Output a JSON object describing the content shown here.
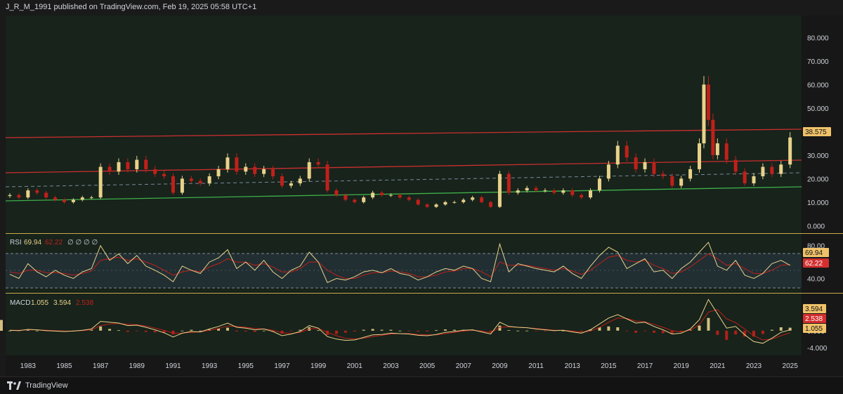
{
  "header": {
    "published": "J_R_M_1991 published on TradingView.com, Feb 19, 2025 05:58 UTC+1"
  },
  "footer": {
    "brand": "TradingView"
  },
  "colors": {
    "background": "#17231b",
    "up_candle": "#e8d28a",
    "down_candle": "#c0201a",
    "upper_channel": "#cc2f2f",
    "lower_channel": "#3fae4a",
    "dashed_mid": "#7a8a9a",
    "rsi_line": "#e8d28a",
    "rsi_signal": "#c0201a",
    "macd_line": "#e8d28a",
    "macd_signal": "#c0201a",
    "label_gold": "#f0c36a",
    "label_red": "#d32f2f"
  },
  "chart_data": [
    {
      "type": "candlestick",
      "name": "price",
      "x_ticks": [
        "1983",
        "1985",
        "1987",
        "1989",
        "1991",
        "1993",
        "1995",
        "1997",
        "1999",
        "2001",
        "2003",
        "2005",
        "2007",
        "2009",
        "2011",
        "2013",
        "2015",
        "2017",
        "2019",
        "2021",
        "2023",
        "2025"
      ],
      "y_ticks": [
        "80.000",
        "70.000",
        "60.000",
        "50.000",
        "40.000",
        "30.000",
        "20.000",
        "10.000",
        "0.000"
      ],
      "ylim": [
        -2,
        87
      ],
      "last_value": "38.575",
      "x": [
        1982.0,
        1982.5,
        1983.0,
        1983.5,
        1984.0,
        1984.5,
        1985.0,
        1985.5,
        1986.0,
        1986.5,
        1987.0,
        1987.5,
        1988.0,
        1988.5,
        1989.0,
        1989.5,
        1990.0,
        1990.5,
        1991.0,
        1991.5,
        1992.0,
        1992.5,
        1993.0,
        1993.5,
        1994.0,
        1994.5,
        1995.0,
        1995.5,
        1996.0,
        1996.5,
        1997.0,
        1997.5,
        1998.0,
        1998.5,
        1999.0,
        1999.5,
        2000.0,
        2000.5,
        2001.0,
        2001.5,
        2002.0,
        2002.5,
        2003.0,
        2003.5,
        2004.0,
        2004.5,
        2005.0,
        2005.5,
        2006.0,
        2006.5,
        2007.0,
        2007.5,
        2008.0,
        2008.5,
        2009.0,
        2009.5,
        2010.0,
        2010.5,
        2011.0,
        2011.5,
        2012.0,
        2012.5,
        2013.0,
        2013.5,
        2014.0,
        2014.5,
        2015.0,
        2015.5,
        2016.0,
        2016.5,
        2017.0,
        2017.5,
        2018.0,
        2018.5,
        2019.0,
        2019.5,
        2020.0,
        2020.25,
        2020.5,
        2020.75,
        2021.0,
        2021.5,
        2022.0,
        2022.5,
        2023.0,
        2023.5,
        2024.0,
        2024.5,
        2025.0
      ],
      "close": [
        13,
        12,
        15,
        14,
        12,
        11,
        10,
        11,
        12,
        12,
        25,
        23,
        27,
        24,
        28,
        24,
        22,
        21,
        14,
        20,
        19,
        18,
        21,
        24,
        29,
        23,
        25,
        22,
        24,
        21,
        17,
        18,
        20,
        27,
        26,
        15,
        13,
        11,
        10,
        12,
        14,
        13,
        13,
        12,
        11,
        9,
        8,
        9,
        10,
        10,
        11,
        12,
        10,
        8,
        22,
        14,
        15,
        16,
        15,
        15,
        14,
        15,
        13,
        12,
        15,
        20,
        26,
        34,
        29,
        24,
        27,
        22,
        21,
        17,
        20,
        24,
        35,
        60,
        45,
        30,
        35,
        28,
        23,
        18,
        21,
        25,
        22,
        26,
        37.5
      ],
      "rsi": {
        "value": "69.94",
        "signal": "62.22",
        "y_ticks": [
          "80.00",
          "40.00"
        ],
        "ylim": [
          25,
          90
        ],
        "x": [
          1982.0,
          1982.5,
          1983.0,
          1983.5,
          1984.0,
          1984.5,
          1985.0,
          1985.5,
          1986.0,
          1986.5,
          1987.0,
          1987.5,
          1988.0,
          1988.5,
          1989.0,
          1989.5,
          1990.0,
          1990.5,
          1991.0,
          1991.5,
          1992.0,
          1992.5,
          1993.0,
          1993.5,
          1994.0,
          1994.5,
          1995.0,
          1995.5,
          1996.0,
          1996.5,
          1997.0,
          1997.5,
          1998.0,
          1998.5,
          1999.0,
          1999.5,
          2000.0,
          2000.5,
          2001.0,
          2001.5,
          2002.0,
          2002.5,
          2003.0,
          2003.5,
          2004.0,
          2004.5,
          2005.0,
          2005.5,
          2006.0,
          2006.5,
          2007.0,
          2007.5,
          2008.0,
          2008.5,
          2009.0,
          2009.5,
          2010.0,
          2010.5,
          2011.0,
          2011.5,
          2012.0,
          2012.5,
          2013.0,
          2013.5,
          2014.0,
          2014.5,
          2015.0,
          2015.5,
          2016.0,
          2016.5,
          2017.0,
          2017.5,
          2018.0,
          2018.5,
          2019.0,
          2019.5,
          2020.0,
          2020.5,
          2021.0,
          2021.5,
          2022.0,
          2022.5,
          2023.0,
          2023.5,
          2024.0,
          2024.5,
          2025.0
        ],
        "values": [
          45,
          40,
          58,
          48,
          42,
          50,
          44,
          40,
          48,
          52,
          80,
          62,
          70,
          58,
          68,
          55,
          50,
          44,
          36,
          55,
          50,
          46,
          60,
          65,
          75,
          52,
          60,
          50,
          62,
          48,
          40,
          50,
          55,
          72,
          60,
          35,
          40,
          38,
          42,
          48,
          50,
          47,
          52,
          46,
          44,
          38,
          42,
          48,
          52,
          50,
          55,
          52,
          40,
          36,
          82,
          48,
          58,
          55,
          52,
          50,
          48,
          55,
          46,
          40,
          55,
          68,
          78,
          72,
          52,
          58,
          64,
          48,
          50,
          40,
          52,
          60,
          72,
          84,
          55,
          50,
          62,
          44,
          40,
          46,
          58,
          62,
          56,
          64,
          69.94
        ],
        "signal_values": [
          48,
          46,
          50,
          50,
          47,
          47,
          46,
          44,
          46,
          49,
          62,
          64,
          66,
          62,
          64,
          60,
          56,
          50,
          44,
          48,
          50,
          48,
          54,
          58,
          64,
          60,
          60,
          56,
          58,
          54,
          48,
          48,
          52,
          60,
          60,
          50,
          44,
          40,
          40,
          44,
          47,
          47,
          49,
          48,
          46,
          42,
          42,
          44,
          48,
          49,
          52,
          52,
          48,
          42,
          60,
          56,
          56,
          56,
          54,
          52,
          50,
          52,
          49,
          45,
          50,
          58,
          66,
          68,
          62,
          60,
          62,
          56,
          52,
          46,
          48,
          54,
          62,
          70,
          64,
          56,
          58,
          52,
          46,
          46,
          50,
          56,
          57,
          60,
          62.22
        ]
      },
      "macd": {
        "value": "1.055",
        "signal": "3.594",
        "histogram": "2.538",
        "y_ticks": [
          "0.000",
          "-4.000"
        ],
        "ylim": [
          -5.2,
          7.8
        ],
        "x": [
          1982.0,
          1982.5,
          1983.0,
          1983.5,
          1984.0,
          1984.5,
          1985.0,
          1985.5,
          1986.0,
          1986.5,
          1987.0,
          1987.5,
          1988.0,
          1988.5,
          1989.0,
          1989.5,
          1990.0,
          1990.5,
          1991.0,
          1991.5,
          1992.0,
          1992.5,
          1993.0,
          1993.5,
          1994.0,
          1994.5,
          1995.0,
          1995.5,
          1996.0,
          1996.5,
          1997.0,
          1997.5,
          1998.0,
          1998.5,
          1999.0,
          1999.5,
          2000.0,
          2000.5,
          2001.0,
          2001.5,
          2002.0,
          2002.5,
          2003.0,
          2003.5,
          2004.0,
          2004.5,
          2005.0,
          2005.5,
          2006.0,
          2006.5,
          2007.0,
          2007.5,
          2008.0,
          2008.5,
          2009.0,
          2009.5,
          2010.0,
          2010.5,
          2011.0,
          2011.5,
          2012.0,
          2012.5,
          2013.0,
          2013.5,
          2014.0,
          2014.5,
          2015.0,
          2015.5,
          2016.0,
          2016.5,
          2017.0,
          2017.5,
          2018.0,
          2018.5,
          2019.0,
          2019.5,
          2020.0,
          2020.5,
          2021.0,
          2021.5,
          2022.0,
          2022.5,
          2023.0,
          2023.5,
          2024.0,
          2024.5,
          2025.0
        ],
        "values": [
          0.1,
          0.0,
          0.3,
          0.2,
          0.0,
          -0.1,
          -0.2,
          -0.1,
          0.1,
          0.4,
          2.2,
          2.0,
          1.8,
          1.2,
          1.3,
          0.8,
          0.2,
          -0.5,
          -1.5,
          -0.6,
          -0.2,
          -0.3,
          0.4,
          1.0,
          1.8,
          0.8,
          0.6,
          0.2,
          0.4,
          -0.2,
          -1.2,
          -0.8,
          -0.2,
          1.2,
          0.6,
          -1.4,
          -2.0,
          -2.3,
          -2.2,
          -1.6,
          -1.0,
          -0.9,
          -0.6,
          -0.7,
          -0.8,
          -1.1,
          -1.2,
          -0.9,
          -0.4,
          -0.2,
          0.1,
          0.2,
          -0.3,
          -0.8,
          2.0,
          1.0,
          0.8,
          0.7,
          0.4,
          0.2,
          0.0,
          0.1,
          -0.3,
          -0.6,
          0.2,
          1.6,
          3.0,
          3.8,
          2.8,
          1.8,
          2.0,
          1.0,
          0.2,
          -0.8,
          -0.6,
          0.4,
          2.6,
          7.4,
          4.0,
          0.6,
          1.0,
          -1.0,
          -2.6,
          -3.0,
          -1.8,
          -0.4,
          0.2,
          1.0,
          1.055
        ],
        "signal_values": [
          0.1,
          0.1,
          0.2,
          0.2,
          0.1,
          0.0,
          -0.1,
          -0.1,
          0.0,
          0.2,
          1.2,
          1.6,
          1.7,
          1.5,
          1.4,
          1.1,
          0.6,
          0.1,
          -0.6,
          -0.6,
          -0.4,
          -0.3,
          0.1,
          0.5,
          1.1,
          1.0,
          0.8,
          0.5,
          0.4,
          0.1,
          -0.5,
          -0.7,
          -0.4,
          0.4,
          0.5,
          -0.4,
          -1.2,
          -1.8,
          -2.0,
          -1.8,
          -1.4,
          -1.1,
          -0.8,
          -0.7,
          -0.7,
          -0.9,
          -1.0,
          -1.0,
          -0.7,
          -0.4,
          -0.1,
          0.1,
          -0.1,
          -0.5,
          0.8,
          0.9,
          0.8,
          0.7,
          0.5,
          0.3,
          0.1,
          0.1,
          -0.1,
          -0.4,
          -0.1,
          0.8,
          2.0,
          3.0,
          2.9,
          2.3,
          2.1,
          1.5,
          0.8,
          0.0,
          -0.3,
          0.1,
          1.4,
          4.4,
          5.0,
          2.8,
          1.9,
          0.4,
          -1.2,
          -2.2,
          -2.0,
          -1.2,
          -0.5,
          0.8,
          3.594
        ],
        "histogram_values": [
          0.0,
          -0.1,
          0.1,
          0.0,
          -0.1,
          -0.1,
          -0.1,
          0.0,
          0.1,
          0.2,
          1.0,
          0.4,
          0.1,
          -0.3,
          -0.1,
          -0.3,
          -0.4,
          -0.6,
          -0.9,
          0.0,
          0.2,
          0.0,
          0.3,
          0.5,
          0.7,
          -0.2,
          -0.2,
          -0.3,
          0.0,
          -0.3,
          -0.7,
          -0.1,
          0.2,
          0.8,
          0.1,
          -1.0,
          -0.8,
          -0.5,
          -0.2,
          0.2,
          0.4,
          0.2,
          0.2,
          0.0,
          -0.1,
          -0.2,
          -0.2,
          0.1,
          0.3,
          0.2,
          0.2,
          0.1,
          -0.2,
          -0.3,
          1.2,
          0.1,
          0.0,
          0.0,
          -0.1,
          -0.1,
          -0.1,
          0.0,
          -0.2,
          -0.2,
          0.3,
          0.8,
          1.0,
          0.8,
          -0.1,
          -0.5,
          -0.1,
          -0.5,
          -0.6,
          -0.8,
          -0.3,
          0.3,
          1.2,
          3.0,
          -1.0,
          -2.2,
          -0.9,
          -1.4,
          -1.4,
          -0.8,
          0.2,
          0.8,
          0.7,
          0.2,
          2.538
        ]
      }
    }
  ]
}
